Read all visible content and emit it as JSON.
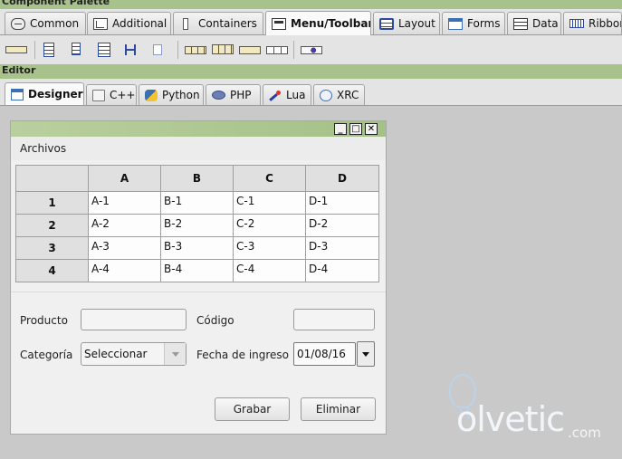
{
  "palette": {
    "title": "Component Palette",
    "tabs": [
      {
        "label": "Common",
        "icon": "common-icon",
        "active": false
      },
      {
        "label": "Additional",
        "icon": "additional-icon",
        "active": false
      },
      {
        "label": "Containers",
        "icon": "containers-icon",
        "active": false
      },
      {
        "label": "Menu/Toolbar",
        "icon": "menu-toolbar-icon",
        "active": true
      },
      {
        "label": "Layout",
        "icon": "layout-icon",
        "active": false
      },
      {
        "label": "Forms",
        "icon": "forms-icon",
        "active": false
      },
      {
        "label": "Data",
        "icon": "data-icon",
        "active": false
      },
      {
        "label": "Ribbon",
        "icon": "ribbon-icon",
        "active": false
      }
    ],
    "toolbar_icons": [
      "menubar-icon",
      "menu-icon",
      "menu-item-icon",
      "submenu-icon",
      "separator-item-icon",
      "seperator-icon",
      "toolbar-icon",
      "aui-toolbar-icon",
      "tool-icon",
      "tool-separator-icon",
      "statusbar-icon"
    ]
  },
  "editor": {
    "title": "Editor",
    "tabs": [
      {
        "label": "Designer",
        "icon": "designer-icon",
        "active": true
      },
      {
        "label": "C++",
        "icon": "cpp-file-icon",
        "active": false
      },
      {
        "label": "Python",
        "icon": "python-icon",
        "active": false
      },
      {
        "label": "PHP",
        "icon": "php-icon",
        "active": false
      },
      {
        "label": "Lua",
        "icon": "lua-icon",
        "active": false
      },
      {
        "label": "XRC",
        "icon": "xrc-icon",
        "active": false
      }
    ]
  },
  "form": {
    "window_buttons": {
      "minimize": "_",
      "maximize": "□",
      "close": "✕"
    },
    "menu": {
      "archivos": "Archivos"
    },
    "grid": {
      "columns": [
        "A",
        "B",
        "C",
        "D"
      ],
      "rows": [
        {
          "label": "1",
          "cells": [
            "A-1",
            "B-1",
            "C-1",
            "D-1"
          ]
        },
        {
          "label": "2",
          "cells": [
            "A-2",
            "B-2",
            "C-2",
            "D-2"
          ]
        },
        {
          "label": "3",
          "cells": [
            "A-3",
            "B-3",
            "C-3",
            "D-3"
          ]
        },
        {
          "label": "4",
          "cells": [
            "A-4",
            "B-4",
            "C-4",
            "D-4"
          ]
        }
      ]
    },
    "fields": {
      "producto_label": "Producto",
      "producto_value": "",
      "codigo_label": "Código",
      "codigo_value": "",
      "categoria_label": "Categoría",
      "categoria_value": "Seleccionar",
      "fecha_label": "Fecha de ingreso",
      "fecha_value": "01/08/16"
    },
    "buttons": {
      "grabar": "Grabar",
      "eliminar": "Eliminar"
    }
  },
  "watermark": {
    "text": "olvetic",
    "suffix": ".com"
  }
}
